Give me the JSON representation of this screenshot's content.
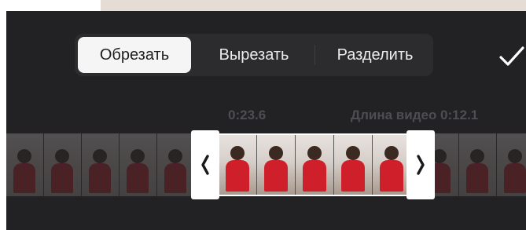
{
  "toolbar": {
    "tabs": [
      {
        "label": "Обрезать",
        "active": true
      },
      {
        "label": "Вырезать",
        "active": false
      },
      {
        "label": "Разделить",
        "active": false
      }
    ],
    "confirm_icon": "checkmark-icon"
  },
  "timeline": {
    "current_time": "0:23.6",
    "duration_label": "Длина видео 0:12.1",
    "left_handle_icon": "chevron-left-icon",
    "right_handle_icon": "chevron-right-icon"
  },
  "colors": {
    "panel_background": "#222224",
    "segment_background": "#2c2c2e",
    "active_tab": "#f5f5f5",
    "time_label": "#4e4e52",
    "top_strip": "#e6dcd6"
  }
}
